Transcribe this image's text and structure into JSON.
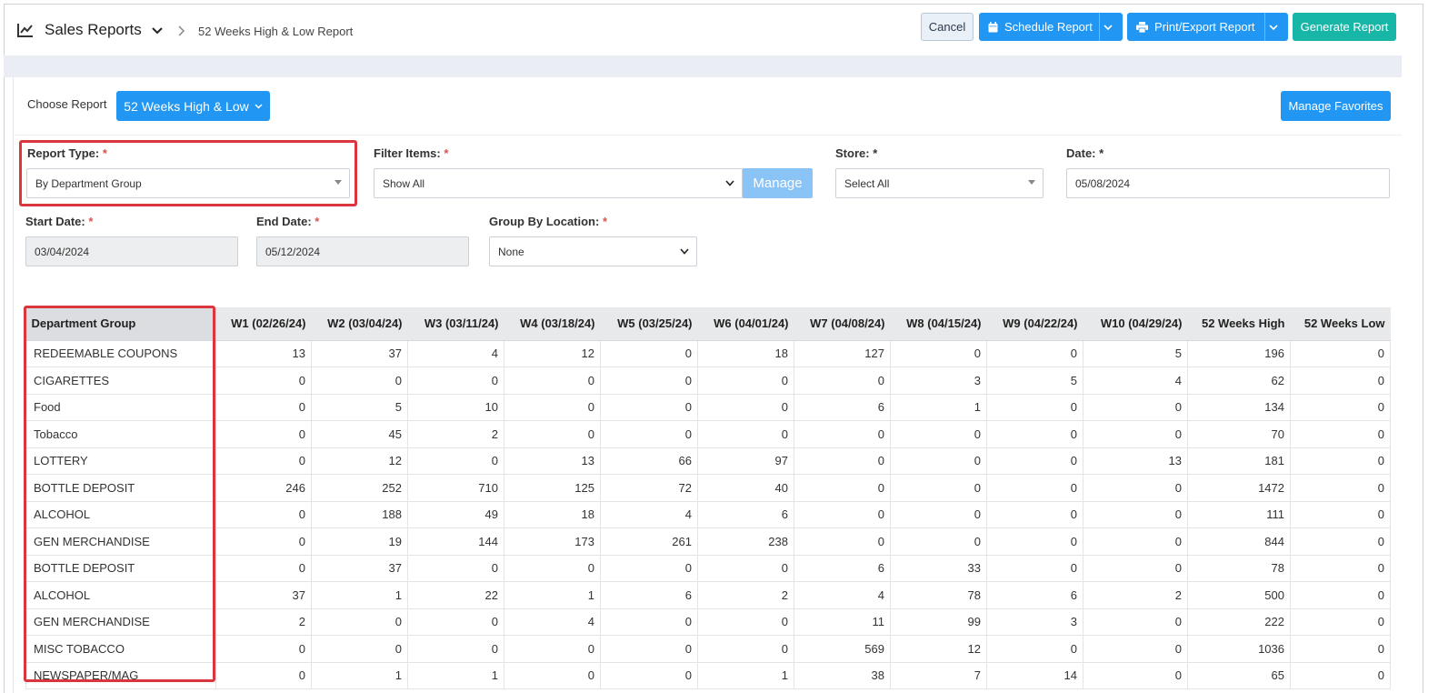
{
  "header": {
    "title": "Sales Reports",
    "breadcrumb": "52 Weeks High & Low Report",
    "cancel": "Cancel",
    "schedule": "Schedule Report",
    "print_export": "Print/Export Report",
    "generate": "Generate Report"
  },
  "choose": {
    "label": "Choose Report",
    "selected": "52 Weeks High & Low",
    "favorites": "Manage Favorites"
  },
  "filters": {
    "report_type_label": "Report Type:",
    "report_type_value": "By Department Group",
    "filter_items_label": "Filter Items:",
    "filter_items_value": "Show All",
    "manage": "Manage",
    "store_label": "Store:",
    "store_value": "Select All",
    "date_label": "Date:",
    "date_value": "05/08/2024",
    "start_label": "Start Date:",
    "start_value": "03/04/2024",
    "end_label": "End Date:",
    "end_value": "05/12/2024",
    "group_label": "Group By Location:",
    "group_value": "None",
    "required_mark": "*"
  },
  "table": {
    "columns": [
      "Department Group",
      "W1 (02/26/24)",
      "W2 (03/04/24)",
      "W3 (03/11/24)",
      "W4 (03/18/24)",
      "W5 (03/25/24)",
      "W6 (04/01/24)",
      "W7 (04/08/24)",
      "W8 (04/15/24)",
      "W9 (04/22/24)",
      "W10 (04/29/24)",
      "52 Weeks High",
      "52 Weeks Low"
    ],
    "rows": [
      [
        "REDEEMABLE COUPONS",
        "13",
        "37",
        "4",
        "12",
        "0",
        "18",
        "127",
        "0",
        "0",
        "5",
        "196",
        "0"
      ],
      [
        "CIGARETTES",
        "0",
        "0",
        "0",
        "0",
        "0",
        "0",
        "0",
        "3",
        "5",
        "4",
        "62",
        "0"
      ],
      [
        "Food",
        "0",
        "5",
        "10",
        "0",
        "0",
        "0",
        "6",
        "1",
        "0",
        "0",
        "134",
        "0"
      ],
      [
        "Tobacco",
        "0",
        "45",
        "2",
        "0",
        "0",
        "0",
        "0",
        "0",
        "0",
        "0",
        "70",
        "0"
      ],
      [
        "LOTTERY",
        "0",
        "12",
        "0",
        "13",
        "66",
        "97",
        "0",
        "0",
        "0",
        "13",
        "181",
        "0"
      ],
      [
        "BOTTLE DEPOSIT",
        "246",
        "252",
        "710",
        "125",
        "72",
        "40",
        "0",
        "0",
        "0",
        "0",
        "1472",
        "0"
      ],
      [
        "ALCOHOL",
        "0",
        "188",
        "49",
        "18",
        "4",
        "6",
        "0",
        "0",
        "0",
        "0",
        "111",
        "0"
      ],
      [
        "GEN MERCHANDISE",
        "0",
        "19",
        "144",
        "173",
        "261",
        "238",
        "0",
        "0",
        "0",
        "0",
        "844",
        "0"
      ],
      [
        "BOTTLE DEPOSIT",
        "0",
        "37",
        "0",
        "0",
        "0",
        "0",
        "6",
        "33",
        "0",
        "0",
        "78",
        "0"
      ],
      [
        "ALCOHOL",
        "37",
        "1",
        "22",
        "1",
        "6",
        "2",
        "4",
        "78",
        "6",
        "2",
        "500",
        "0"
      ],
      [
        "GEN MERCHANDISE",
        "2",
        "0",
        "0",
        "4",
        "0",
        "0",
        "11",
        "99",
        "3",
        "0",
        "222",
        "0"
      ],
      [
        "MISC TOBACCO",
        "0",
        "0",
        "0",
        "0",
        "0",
        "0",
        "569",
        "12",
        "0",
        "0",
        "1036",
        "0"
      ],
      [
        "NEWSPAPER/MAG",
        "0",
        "1",
        "1",
        "0",
        "0",
        "1",
        "38",
        "7",
        "14",
        "0",
        "65",
        "0"
      ]
    ]
  },
  "icons": {
    "brand": "line-chart-icon",
    "schedule": "calendar-icon",
    "print": "printer-icon"
  },
  "colors": {
    "primary": "#2196f3",
    "teal": "#17b6a7",
    "highlight": "#d9363e"
  }
}
